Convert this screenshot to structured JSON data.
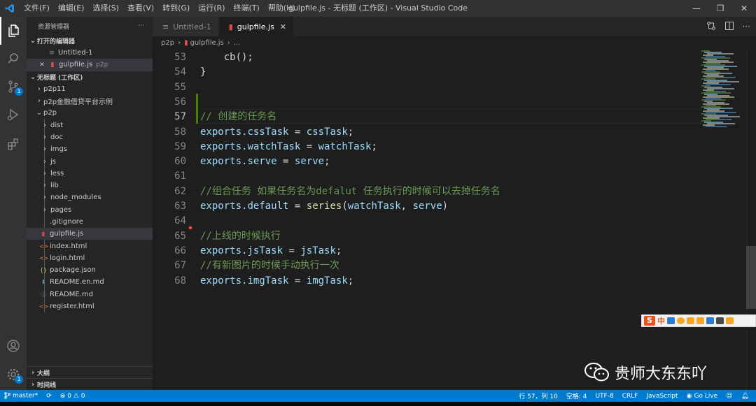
{
  "window": {
    "title": "gulpfile.js - 无标题 (工作区) - Visual Studio Code",
    "menu": [
      "文件(F)",
      "编辑(E)",
      "选择(S)",
      "查看(V)",
      "转到(G)",
      "运行(R)",
      "终端(T)",
      "帮助(H)"
    ]
  },
  "activity": {
    "scm_badge": "1",
    "settings_badge": "1"
  },
  "sidebar": {
    "header": "资源管理器",
    "more": "···",
    "open_editors_title": "打开的编辑器",
    "open_editors": [
      {
        "label": "Untitled-1",
        "desc": ""
      },
      {
        "label": "gulpfile.js",
        "desc": "p2p"
      }
    ],
    "workspace_title": "无标题 (工作区)",
    "folders": [
      "p2p11",
      "p2p金融借贷平台示例",
      "p2p"
    ],
    "p2p_children": [
      "dist",
      "doc",
      "imgs",
      "js",
      "less",
      "lib",
      "node_modules",
      "pages"
    ],
    "p2p_files": [
      {
        "label": ".gitignore",
        "icon": "",
        "color": "#cccccc"
      },
      {
        "label": "gulpfile.js",
        "icon": "gulp-icon",
        "color": "#e04f4f"
      },
      {
        "label": "index.html",
        "icon": "html-icon",
        "color": "#e37933"
      },
      {
        "label": "login.html",
        "icon": "html-icon",
        "color": "#e37933"
      },
      {
        "label": "package.json",
        "icon": "json-icon",
        "color": "#cbcb41"
      },
      {
        "label": "README.en.md",
        "icon": "markdown-icon",
        "color": "#519aba"
      },
      {
        "label": "README.md",
        "icon": "info-icon",
        "color": "#519aba"
      },
      {
        "label": "register.html",
        "icon": "html-icon",
        "color": "#e37933"
      }
    ],
    "outline_title": "大纲",
    "timeline_title": "时间线"
  },
  "tabs": [
    {
      "label": "Untitled-1",
      "active": false
    },
    {
      "label": "gulpfile.js",
      "active": true,
      "close": "✕"
    }
  ],
  "breadcrumb": [
    "p2p",
    "›",
    "gulpfile.js",
    "›",
    "..."
  ],
  "code": {
    "line_numbers": [
      "53",
      "54",
      "55",
      "56",
      "57",
      "58",
      "59",
      "60",
      "61",
      "62",
      "63",
      "64",
      "65",
      "66",
      "67",
      "68"
    ],
    "lines": [
      [
        {
          "t": "    cb();",
          "c": "pl"
        }
      ],
      [
        {
          "t": "}",
          "c": "pl"
        }
      ],
      [],
      [],
      [
        {
          "t": "// 创建的任务名",
          "c": "cmt"
        }
      ],
      [
        {
          "t": "exports",
          "c": "var"
        },
        {
          "t": ".",
          "c": "pl"
        },
        {
          "t": "cssTask",
          "c": "var"
        },
        {
          "t": " = ",
          "c": "pl"
        },
        {
          "t": "cssTask",
          "c": "var"
        },
        {
          "t": ";",
          "c": "pl"
        }
      ],
      [
        {
          "t": "exports",
          "c": "var"
        },
        {
          "t": ".",
          "c": "pl"
        },
        {
          "t": "watchTask",
          "c": "var"
        },
        {
          "t": " = ",
          "c": "pl"
        },
        {
          "t": "watchTask",
          "c": "var"
        },
        {
          "t": ";",
          "c": "pl"
        }
      ],
      [
        {
          "t": "exports",
          "c": "var"
        },
        {
          "t": ".",
          "c": "pl"
        },
        {
          "t": "serve",
          "c": "var"
        },
        {
          "t": " = ",
          "c": "pl"
        },
        {
          "t": "serve",
          "c": "var"
        },
        {
          "t": ";",
          "c": "pl"
        }
      ],
      [],
      [
        {
          "t": "//组合任务 如果任务名为defalut 任务执行的时候可以去掉任务名",
          "c": "cmt"
        }
      ],
      [
        {
          "t": "exports",
          "c": "var"
        },
        {
          "t": ".",
          "c": "pl"
        },
        {
          "t": "default",
          "c": "var"
        },
        {
          "t": " = ",
          "c": "pl"
        },
        {
          "t": "series",
          "c": "fn"
        },
        {
          "t": "(",
          "c": "pl"
        },
        {
          "t": "watchTask",
          "c": "var"
        },
        {
          "t": ", ",
          "c": "pl"
        },
        {
          "t": "serve",
          "c": "var"
        },
        {
          "t": ")",
          "c": "pl"
        }
      ],
      [],
      [
        {
          "t": "//上线的时候执行",
          "c": "cmt"
        }
      ],
      [
        {
          "t": "exports",
          "c": "var"
        },
        {
          "t": ".",
          "c": "pl"
        },
        {
          "t": "jsTask",
          "c": "var"
        },
        {
          "t": " = ",
          "c": "pl"
        },
        {
          "t": "jsTask",
          "c": "var"
        },
        {
          "t": ";",
          "c": "pl"
        }
      ],
      [
        {
          "t": "//有新图片的时候手动执行一次",
          "c": "cmt"
        }
      ],
      [
        {
          "t": "exports",
          "c": "var"
        },
        {
          "t": ".",
          "c": "pl"
        },
        {
          "t": "imgTask",
          "c": "var"
        },
        {
          "t": " = ",
          "c": "pl"
        },
        {
          "t": "imgTask",
          "c": "var"
        },
        {
          "t": ";",
          "c": "pl"
        }
      ]
    ],
    "cursor_line": "57"
  },
  "ime": {
    "logo": "S",
    "lang": "中"
  },
  "watermark": {
    "text": "贵师大东东吖"
  },
  "statusbar": {
    "branch": "master*",
    "sync": "⟳",
    "problems": "⊗ 0 ⚠ 0",
    "position": "行 57，列 10",
    "spaces": "空格: 4",
    "encoding": "UTF-8",
    "eol": "CRLF",
    "language": "JavaScript",
    "golive": "Go Live"
  },
  "colors": {
    "accent": "#007acc",
    "comment": "#6a9955",
    "variable": "#9cdcfe",
    "function": "#dcdcaa"
  }
}
